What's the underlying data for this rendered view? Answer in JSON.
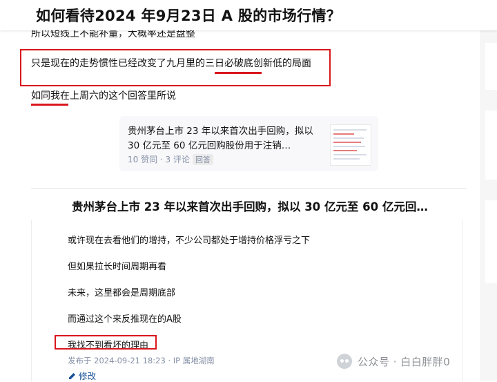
{
  "question": {
    "title": "如何看待2024 年9月23日 A 股的市场行情？"
  },
  "answer": {
    "cut_text": "所以短线上不能补量，大概率还是盘整",
    "line1_pre": "只是现在的走势惯性已经改变了九月里的",
    "line1_mid": "三日必破底",
    "line1_post": "创新低的局面",
    "line2_mid": "如同",
    "line2_post": "我在上周六的这个回答里所说"
  },
  "link_card": {
    "title": "贵州茅台上市 23 年以来首次出手回购，拟以 30 亿元至 60 亿元回购股份用于注销…",
    "upvotes": "10 赞同",
    "dot": " · ",
    "comments": "3 评论",
    "tag": "回答"
  },
  "embedded": {
    "title": "贵州茅台上市 23 年以来首次出手回购，拟以 30 亿元至 60 亿元回…",
    "lines": [
      "或许现在去看他们的增持，不少公司都处于增持价格浮亏之下",
      "但如果拉长时间周期再看",
      "未来，这里都会是周期底部",
      "而通过这个来反推现在的A股",
      "我找不到看坏的理由"
    ],
    "meta": "发布于 2024-09-21 18:23 · IP 属地湖南",
    "edit_label": "修改"
  },
  "watermark": {
    "text": "公众号 · 白白胖胖0"
  },
  "colors": {
    "highlight_red": "#d9161c",
    "link_blue": "#175199",
    "meta_gray": "#8590a6"
  }
}
